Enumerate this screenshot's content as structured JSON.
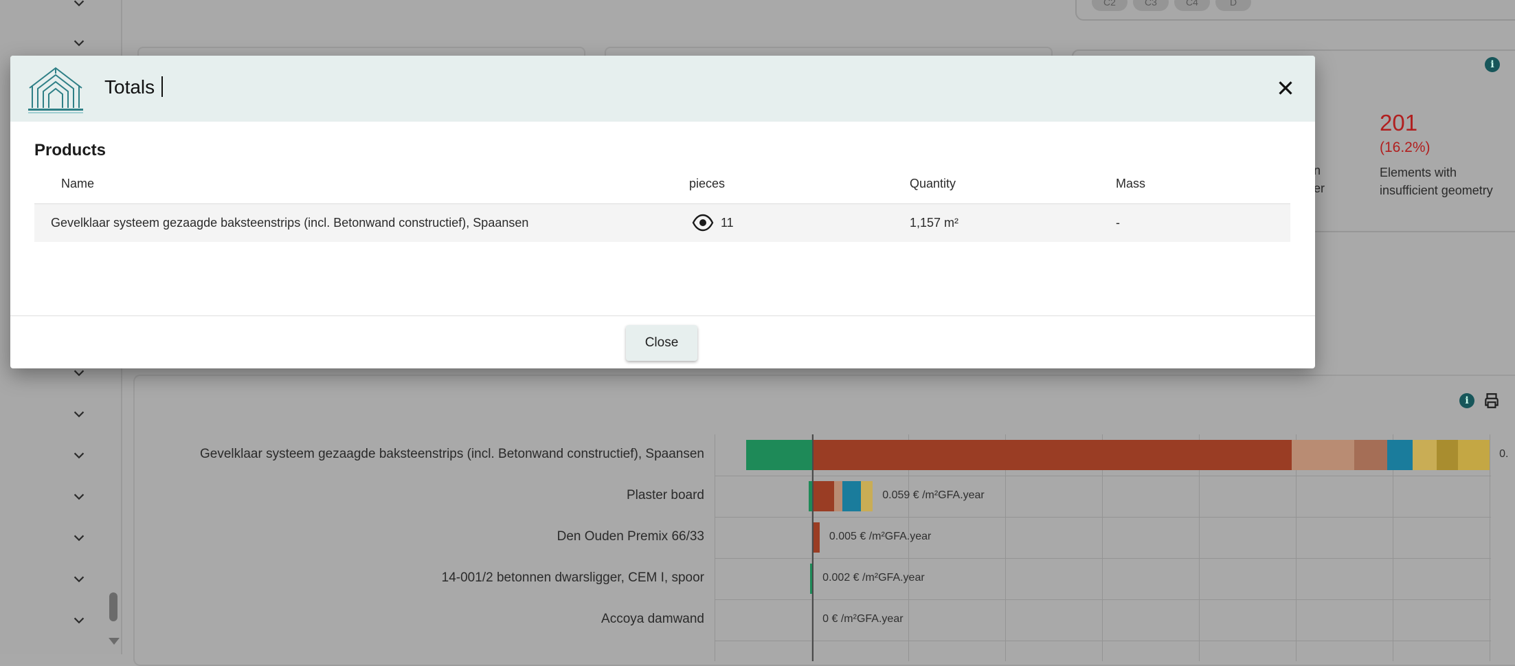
{
  "chips": [
    "C2",
    "C3",
    "C4",
    "D"
  ],
  "stats": {
    "count": "201",
    "percent": "(16.2%)",
    "label": "Elements with insufficient geometry",
    "partial_line1": "n",
    "partial_line2": "er"
  },
  "chart_data": {
    "type": "bar",
    "orientation": "horizontal",
    "stacked": true,
    "unit": "€ /m²GFA.year",
    "categories": [
      "Gevelklaar systeem gezaagde baksteenstrips (incl. Betonwand constructief), Spaansen",
      "Plaster board",
      "Den Ouden Premix 66/33",
      "14-001/2 betonnen dwarsligger, CEM I, spoor",
      "Accoya damwand"
    ],
    "value_labels": [
      "0.",
      "0.059 € /m²GFA.year",
      "0.005 € /m²GFA.year",
      "0.002 € /m²GFA.year",
      "0 € /m²GFA.year"
    ],
    "series": [
      {
        "color": "#1e8a58",
        "values": [
          -0.05,
          -0.003,
          0,
          -0.002,
          0
        ]
      },
      {
        "color": "#9a3d24",
        "values": [
          0.36,
          0.016,
          0.005,
          0,
          0
        ]
      },
      {
        "color": "#b98c73",
        "values": [
          0.047,
          0.006,
          0,
          0,
          0
        ]
      },
      {
        "color": "#a56e56",
        "values": [
          0.025,
          0,
          0,
          0,
          0
        ]
      },
      {
        "color": "#1a7c9c",
        "values": [
          0.019,
          0.014,
          0,
          0,
          0
        ]
      },
      {
        "color": "#c9ad55",
        "values": [
          0.018,
          0.009,
          0,
          0,
          0
        ]
      },
      {
        "color": "#a98d2f",
        "values": [
          0.016,
          0,
          0,
          0,
          0
        ]
      },
      {
        "color": "#c4a744",
        "values": [
          0.024,
          0,
          0,
          0,
          0
        ]
      }
    ],
    "xlim": [
      -0.074,
      0.51
    ],
    "grid": true
  },
  "modal": {
    "title": "Totals",
    "section_title": "Products",
    "columns": [
      "Name",
      "pieces",
      "Quantity",
      "Mass"
    ],
    "rows": [
      {
        "name": "Gevelklaar systeem gezaagde baksteenstrips (incl. Betonwand constructief), Spaansen",
        "pieces": "11",
        "quantity": "1,157 m²",
        "mass": "-"
      }
    ],
    "close_label": "Close"
  },
  "icons": {
    "close": "close-icon",
    "eye": "eye-icon",
    "info": "info-icon",
    "print": "print-icon",
    "chevron": "chevron-down-icon",
    "logo": "house-logo-icon"
  },
  "colors": {
    "header_bg": "#e6efee",
    "alert_red": "#b11f1f",
    "info_teal": "#17565a"
  }
}
